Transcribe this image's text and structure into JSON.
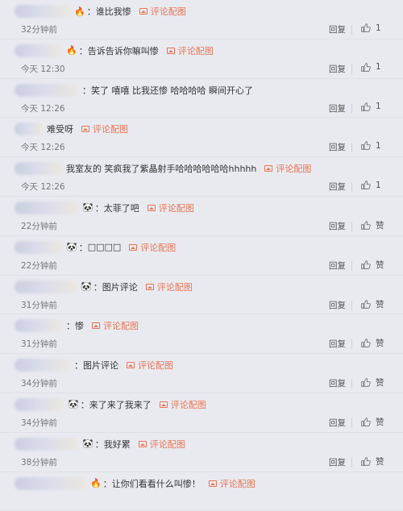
{
  "labels": {
    "reply": "回复",
    "pic": "评论配图",
    "like_word": "赞"
  },
  "colors": {
    "background": "#e9eaf0",
    "accent": "#eb7350"
  },
  "comments": [
    {
      "prefix": "：",
      "text": "谁比我惨",
      "emoji": "fire-icon",
      "has_pic": true,
      "time": "32分钟前",
      "like": "1"
    },
    {
      "prefix": "：",
      "text": "告诉告诉你嘛叫惨",
      "emoji": "fire-icon",
      "has_pic": true,
      "time": "今天 12:30",
      "like": "1"
    },
    {
      "prefix": "：",
      "text": "笑了  嘻嘻  比我还惨  哈哈哈哈  瞬间开心了",
      "emoji": "",
      "has_pic": false,
      "time": "今天 12:26",
      "like": "1"
    },
    {
      "prefix": "",
      "text": "难受呀",
      "emoji": "",
      "has_pic": true,
      "time": "今天 12:26",
      "like": "1"
    },
    {
      "prefix": "",
      "text": "我室友的  笑疯我了紫晶射手哈哈哈哈哈哈hhhhh",
      "emoji": "",
      "has_pic": true,
      "time": "今天 12:26",
      "like": "1"
    },
    {
      "prefix": "：",
      "text": "太菲了吧",
      "emoji": "panda-icon",
      "has_pic": true,
      "time": "22分钟前",
      "like": "赞"
    },
    {
      "prefix": "：",
      "text": "□□□□",
      "emoji": "panda-icon",
      "has_pic": true,
      "time": "22分钟前",
      "like": "赞"
    },
    {
      "prefix": "：",
      "text": "图片评论",
      "emoji": "panda-icon",
      "has_pic": true,
      "time": "31分钟前",
      "like": "赞"
    },
    {
      "prefix": "：",
      "text": "惨",
      "emoji": "",
      "has_pic": true,
      "time": "31分钟前",
      "like": "赞"
    },
    {
      "prefix": "：",
      "text": "图片评论",
      "emoji": "",
      "has_pic": true,
      "time": "34分钟前",
      "like": "赞"
    },
    {
      "prefix": "：",
      "text": "来了来了我来了",
      "emoji": "panda-icon",
      "has_pic": true,
      "time": "34分钟前",
      "like": "赞"
    },
    {
      "prefix": "：",
      "text": "我好累",
      "emoji": "panda-icon",
      "has_pic": true,
      "time": "38分钟前",
      "like": "赞"
    },
    {
      "prefix": "：",
      "text": "让你们看看什么叫惨！",
      "emoji": "fire-icon",
      "has_pic": true,
      "time": "",
      "like": ""
    }
  ]
}
